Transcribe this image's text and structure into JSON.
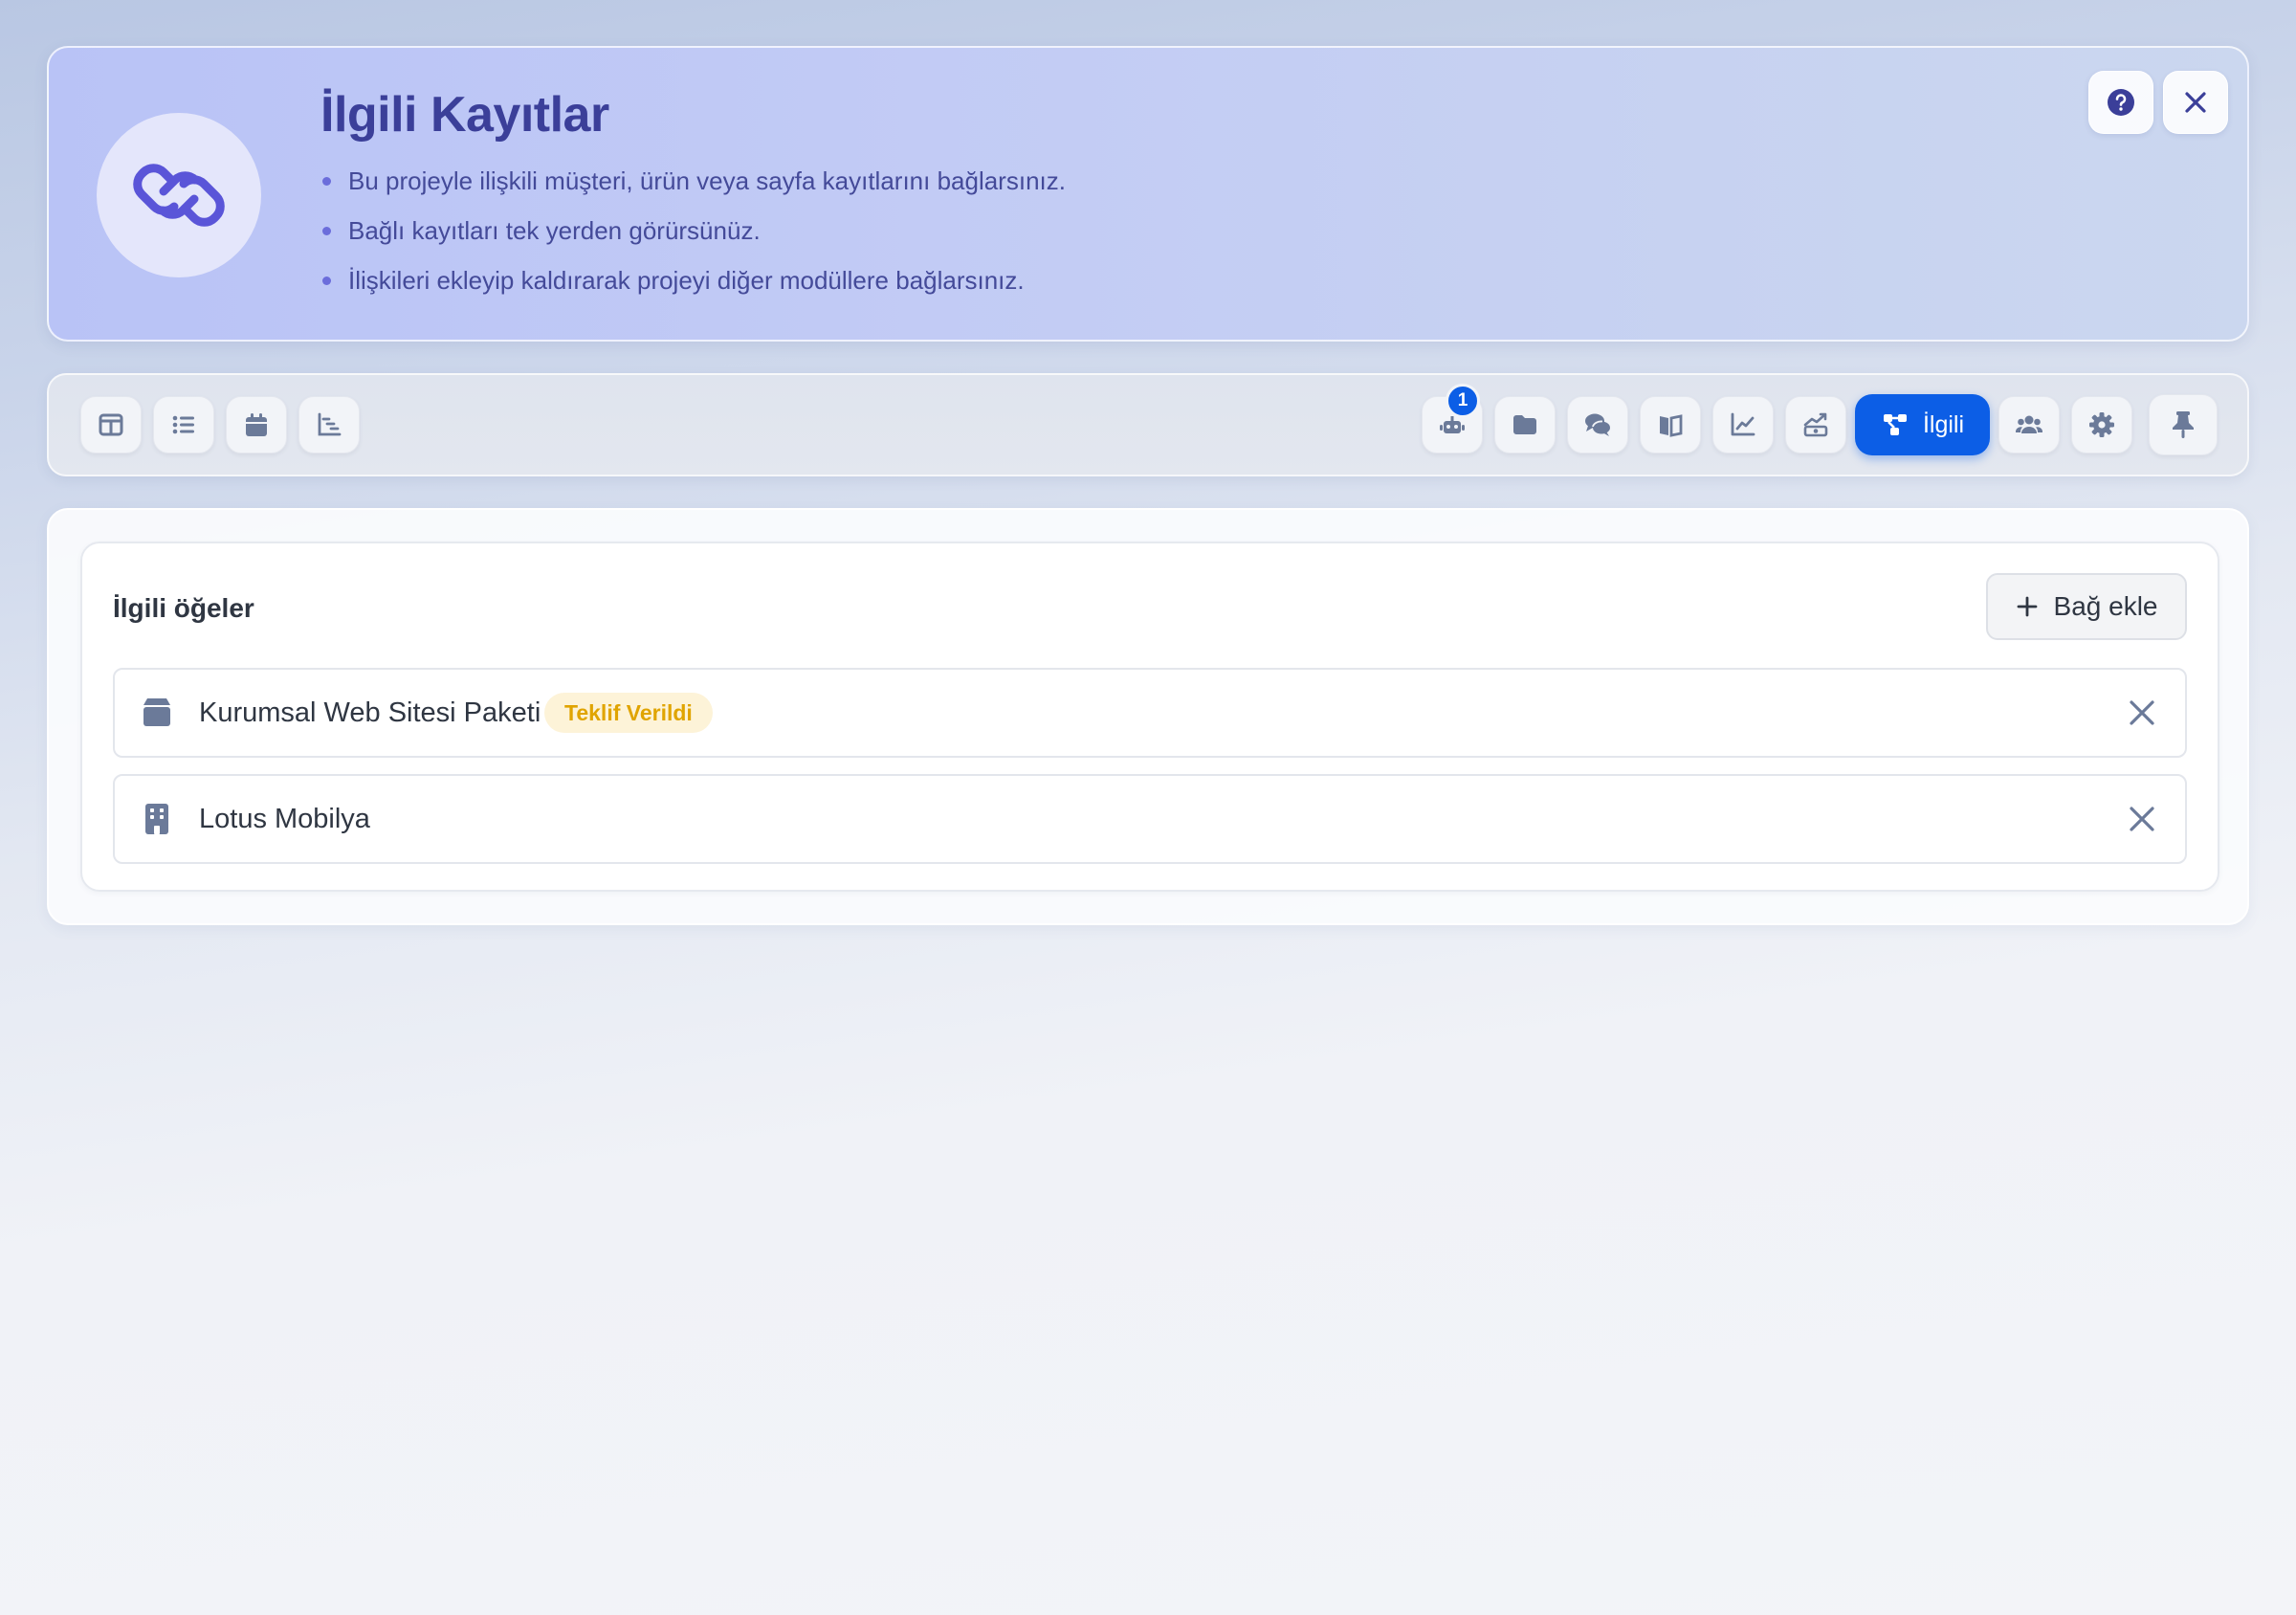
{
  "banner": {
    "title": "İlgili Kayıtlar",
    "bullets": [
      "Bu projeyle ilişkili müşteri, ürün veya sayfa kayıtlarını bağlarsınız.",
      "Bağlı kayıtları tek yerden görürsünüz.",
      "İlişkileri ekleyip kaldırarak projeyi diğer modüllere bağlarsınız."
    ],
    "logo_icon": "link-icon",
    "help_icon": "question-circle-icon",
    "close_icon": "close-icon"
  },
  "toolbar": {
    "view_buttons": [
      "layout-columns-icon",
      "list-icon",
      "calendar-icon",
      "gantt-icon"
    ],
    "module_buttons": [
      {
        "icon": "robot-tasks-icon",
        "badge": "1"
      },
      {
        "icon": "folder-icon"
      },
      {
        "icon": "comments-icon"
      },
      {
        "icon": "book-icon"
      },
      {
        "icon": "line-chart-icon"
      },
      {
        "icon": "growth-chart-icon"
      }
    ],
    "active": {
      "icon": "sitemap-icon",
      "label": "İlgili"
    },
    "after_active": [
      "users-icon",
      "gear-icon"
    ],
    "pin_icon": "thumbtack-icon"
  },
  "related": {
    "title": "İlgili öğeler",
    "add_label": "Bağ ekle",
    "items": [
      {
        "label": "Kurumsal Web Sitesi Paketi",
        "status": "Teklif Verildi",
        "icon": "box-icon"
      },
      {
        "label": "Lotus Mobilya",
        "icon": "building-icon"
      }
    ]
  },
  "colors": {
    "accent": "#0c5ee6",
    "banner_title": "#3b3f99",
    "status_text": "#e0a400",
    "status_bg": "#fdf3d8",
    "icon_gray": "#6b7a99"
  }
}
